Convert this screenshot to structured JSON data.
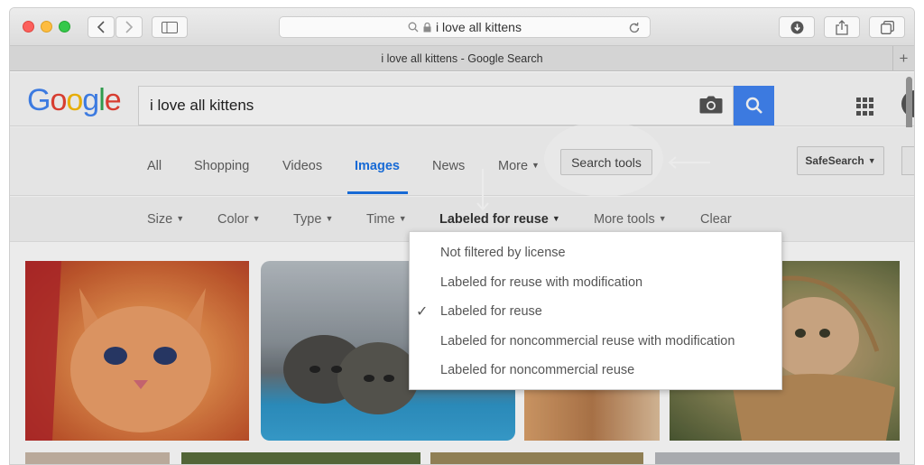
{
  "browser": {
    "address": "i love all kittens",
    "tab_title": "i love all kittens - Google Search",
    "new_tab": "+"
  },
  "google": {
    "logo": [
      "G",
      "o",
      "o",
      "g",
      "l",
      "e"
    ],
    "logo_colors": [
      "#4285f4",
      "#ea4335",
      "#fbbc05",
      "#4285f4",
      "#34a853",
      "#ea4335"
    ],
    "query": "i love all kittens",
    "accent": "#1a73e8"
  },
  "nav": {
    "all": "All",
    "shopping": "Shopping",
    "videos": "Videos",
    "images": "Images",
    "news": "News",
    "more": "More",
    "search_tools": "Search tools",
    "safesearch": "SafeSearch"
  },
  "tools": {
    "size": "Size",
    "color": "Color",
    "type": "Type",
    "time": "Time",
    "labeled": "Labeled for reuse",
    "more_tools": "More tools",
    "clear": "Clear"
  },
  "menu": {
    "items": [
      "Not filtered by license",
      "Labeled for reuse with modification",
      "Labeled for reuse",
      "Labeled for noncommercial reuse with modification",
      "Labeled for noncommercial reuse"
    ],
    "checked_index": 2
  },
  "icons": {
    "search": "magnifier-icon",
    "lock": "lock-icon",
    "reload": "reload-icon",
    "camera": "camera-icon",
    "apps": "apps-grid-icon",
    "download": "download-icon",
    "share": "share-icon",
    "tabs": "tabs-icon",
    "sidebar": "sidebar-icon"
  }
}
